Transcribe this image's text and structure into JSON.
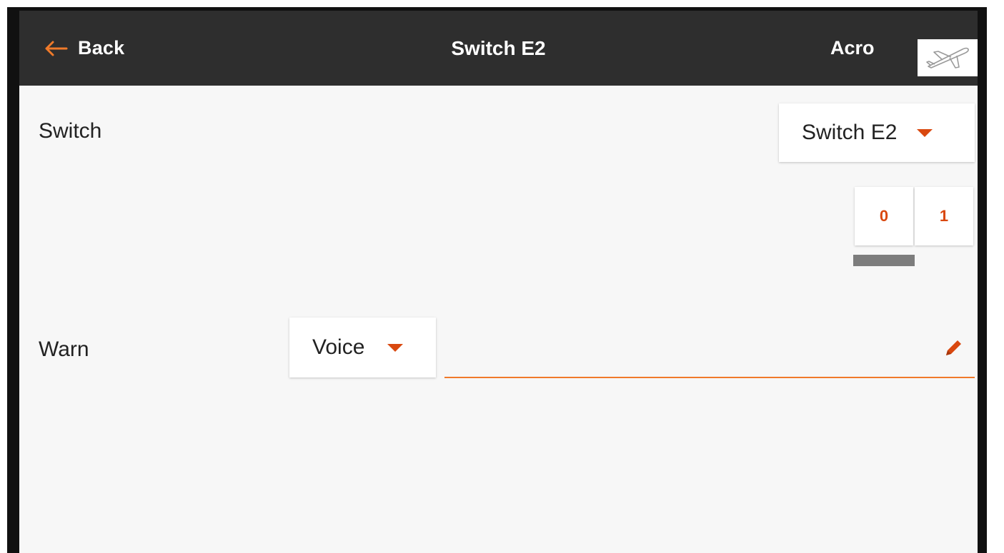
{
  "header": {
    "back_label": "Back",
    "title": "Switch E2",
    "mode": "Acro",
    "back_icon": "arrow-left-icon",
    "model_icon": "airplane-icon"
  },
  "switch_row": {
    "label": "Switch",
    "selected": "Switch E2",
    "positions": [
      "0",
      "1"
    ],
    "active_position_index": 0
  },
  "warn_row": {
    "label": "Warn",
    "type_selected": "Voice",
    "text_value": "",
    "edit_icon": "pencil-icon"
  },
  "colors": {
    "header_bg": "#2e2e2e",
    "accent": "#d9480f",
    "back_arrow": "#f07a2a",
    "underline": "#f07a2a",
    "screen_bg": "#f7f7f7"
  }
}
